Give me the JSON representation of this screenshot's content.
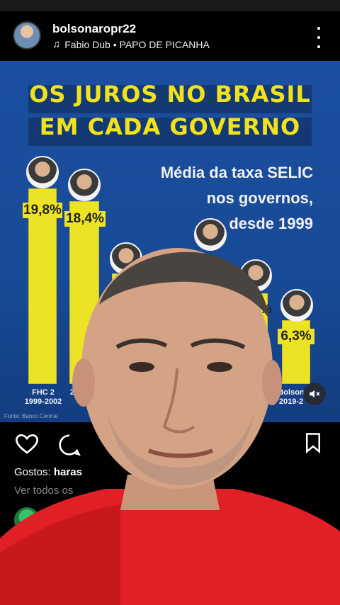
{
  "post": {
    "username": "bolsonaropr22",
    "music": "Fabio Dub • PAPO DE PICANHA"
  },
  "infographic": {
    "title_line1": "OS JUROS NO BRASIL",
    "title_line2": "EM CADA GOVERNO",
    "subtitle_line1": "Média da taxa SELIC",
    "subtitle_line2": "nos governos,",
    "subtitle_line3": "desde 1999",
    "source": "Fonte: Banco Central"
  },
  "chart_data": {
    "type": "bar",
    "title": "OS JUROS NO BRASIL EM CADA GOVERNO",
    "categories": [
      "FHC 2\n1999-2002",
      "20",
      "",
      "",
      "",
      "Bolson\n2019-2"
    ],
    "values": [
      19.8,
      18.4,
      null,
      null,
      null,
      6.3
    ],
    "data_labels": [
      "19,8%",
      "18,4%",
      "",
      "",
      "3%",
      "6,3%"
    ],
    "ylabel": "",
    "xlabel": ""
  },
  "bars": [
    {
      "label": "19,8%",
      "cat1": "FHC 2",
      "cat2": "1999-2002",
      "value": 19.8
    },
    {
      "label": "18,4%",
      "cat1": "20",
      "cat2": "",
      "value": 18.4
    },
    {
      "label": "",
      "cat1": "",
      "cat2": "",
      "value": null
    },
    {
      "label": "",
      "cat1": "",
      "cat2": "",
      "value": null
    },
    {
      "label": "3%",
      "cat1": "",
      "cat2": "",
      "value": null
    },
    {
      "label": "6,3%",
      "cat1": "Bolson",
      "cat2": "2019-2",
      "value": 6.3
    }
  ],
  "engagement": {
    "likes_prefix": "Gostos:",
    "likes_user": "haras",
    "view_comments": "Ver todos os"
  },
  "colors": {
    "background": "#000000",
    "chart_bg": "#1b4fa0",
    "title_yellow": "#f2e21c",
    "bar_yellow": "#ece326",
    "shirt_red": "#e02026"
  },
  "icons": {
    "like": "heart-outline-icon",
    "comment": "comment-bubble-icon",
    "save": "bookmark-outline-icon",
    "mute": "speaker-muted-icon",
    "more": "vertical-dots-icon",
    "music": "music-note-icon"
  }
}
